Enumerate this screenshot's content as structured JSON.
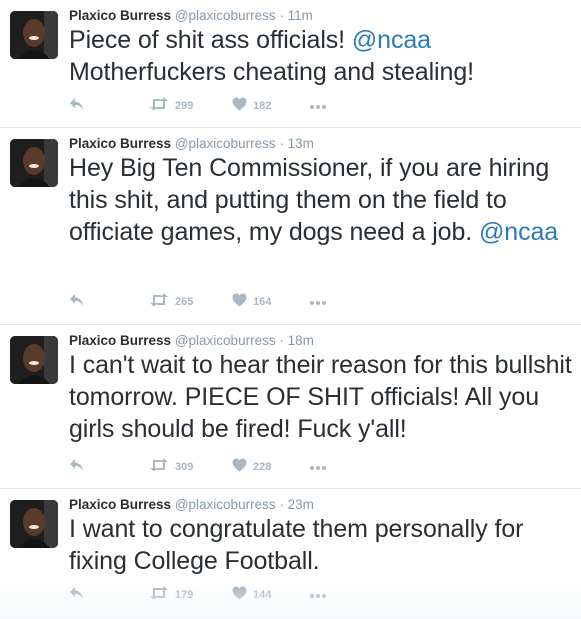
{
  "tweets": [
    {
      "fullname": "Plaxico Burress",
      "username": "@plaxicoburress",
      "dot": "·",
      "time": "11m",
      "text_parts": [
        "Piece of shit ass officials! ",
        "@ncaa",
        " Motherfuckers cheating and stealing!"
      ],
      "retweets": "299",
      "likes": "182"
    },
    {
      "fullname": "Plaxico Burress",
      "username": "@plaxicoburress",
      "dot": "·",
      "time": "13m",
      "text_parts": [
        "Hey Big Ten Commissioner, if you are hiring this shit, and putting them on the field to officiate games, my dogs need a job. ",
        "@ncaa"
      ],
      "retweets": "265",
      "likes": "164"
    },
    {
      "fullname": "Plaxico Burress",
      "username": "@plaxicoburress",
      "dot": "·",
      "time": "18m",
      "text_parts": [
        "I can't wait to hear their reason for this bullshit tomorrow. PIECE OF SHIT officials! All you girls should be fired! Fuck y'all!"
      ],
      "retweets": "309",
      "likes": "228"
    },
    {
      "fullname": "Plaxico Burress",
      "username": "@plaxicoburress",
      "dot": "·",
      "time": "23m",
      "text_parts": [
        "I want to congratulate them personally for fixing College Football."
      ],
      "retweets": "179",
      "likes": "144"
    }
  ],
  "icons": {
    "reply": "reply-icon",
    "retweet": "retweet-icon",
    "like": "heart-icon",
    "more": "more-dots-icon"
  },
  "colors": {
    "mention": "#2b7bb9",
    "meta": "#8899a6",
    "action": "#aab8c2",
    "divider": "#e1e8ed"
  }
}
